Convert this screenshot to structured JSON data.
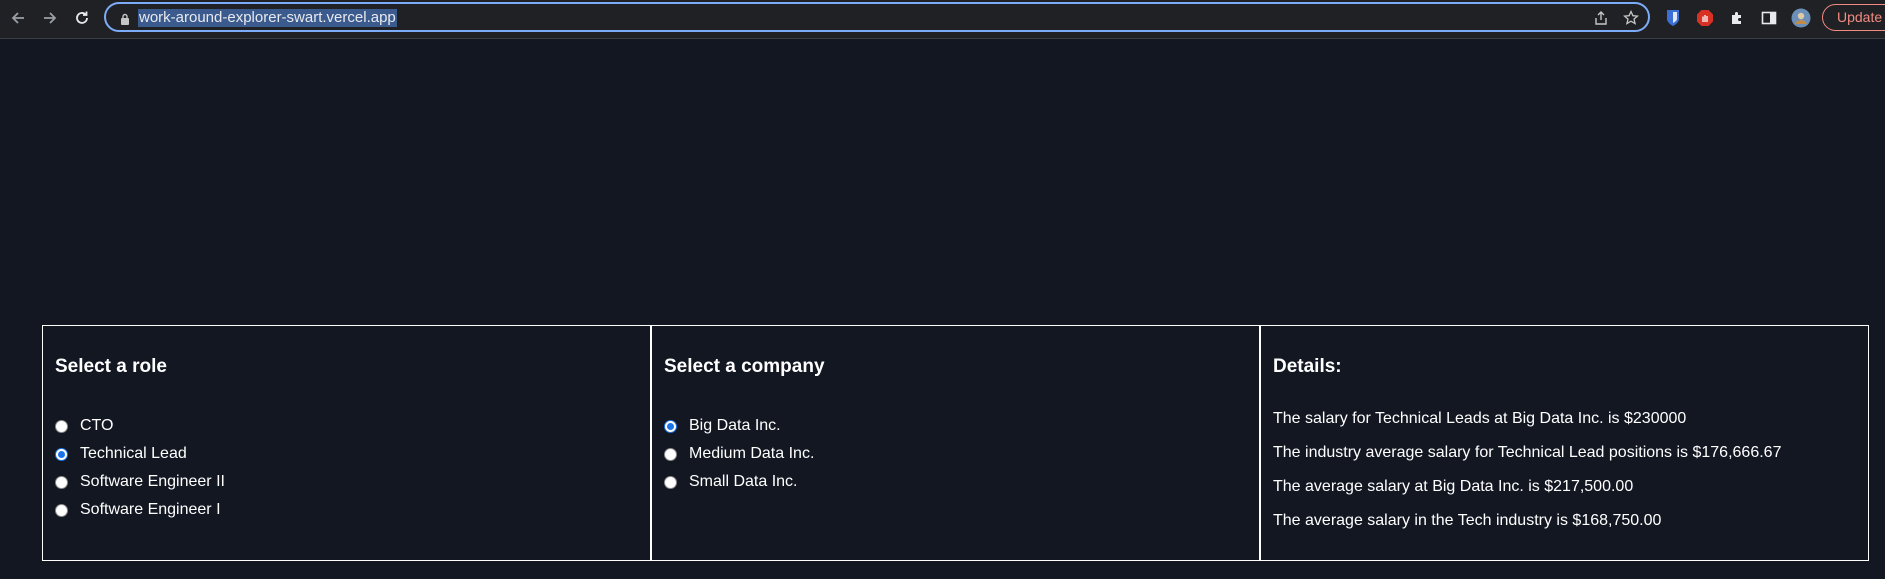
{
  "browser": {
    "url": "work-around-explorer-swart.vercel.app",
    "update_label": "Update",
    "icons": [
      "back-icon",
      "forward-icon",
      "reload-icon",
      "lock-icon",
      "share-icon",
      "star-icon",
      "extension-icon",
      "puzzle-icon",
      "side-panel-icon",
      "profile-avatar"
    ]
  },
  "role_panel": {
    "title": "Select a role",
    "options": [
      {
        "label": "CTO",
        "checked": false
      },
      {
        "label": "Technical Lead",
        "checked": true
      },
      {
        "label": "Software Engineer II",
        "checked": false
      },
      {
        "label": "Software Engineer I",
        "checked": false
      }
    ]
  },
  "company_panel": {
    "title": "Select a company",
    "options": [
      {
        "label": "Big Data Inc.",
        "checked": true
      },
      {
        "label": "Medium Data Inc.",
        "checked": false
      },
      {
        "label": "Small Data Inc.",
        "checked": false
      }
    ]
  },
  "details_panel": {
    "title": "Details:",
    "lines": [
      "The salary for Technical Leads at Big Data Inc. is $230000",
      "The industry average salary for Technical Lead positions is $176,666.67",
      "The average salary at Big Data Inc. is $217,500.00",
      "The average salary in the Tech industry is $168,750.00"
    ]
  },
  "colors": {
    "page_background": "#131722",
    "accent": "#1a73e8",
    "update_border": "#f28b82"
  }
}
